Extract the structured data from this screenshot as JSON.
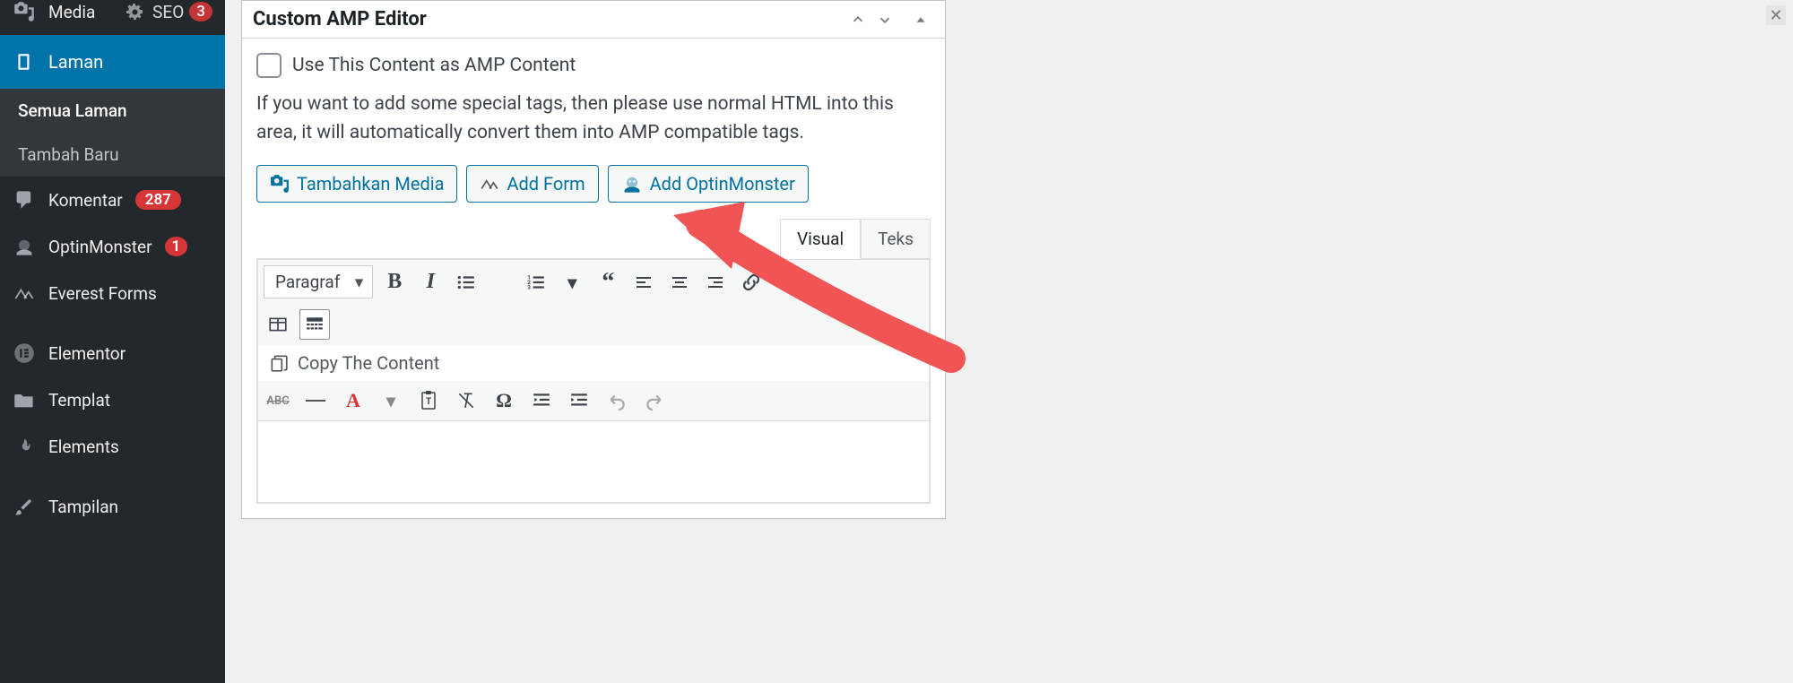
{
  "sidebar": {
    "media": "Media",
    "laman": "Laman",
    "semua_laman": "Semua Laman",
    "tambah_baru": "Tambah Baru",
    "komentar": "Komentar",
    "komentar_badge": "287",
    "optin": "OptinMonster",
    "optin_badge": "1",
    "everest": "Everest Forms",
    "elementor": "Elementor",
    "templat": "Templat",
    "elements": "Elements",
    "tampilan": "Tampilan",
    "seo": "SEO",
    "seo_badge": "3"
  },
  "panel": {
    "title": "Custom AMP Editor",
    "checkbox_label": "Use This Content as AMP Content",
    "description": "If you want to add some special tags, then please use normal HTML into this area, it will automatically convert them into AMP compatible tags.",
    "btn_media": "Tambahkan Media",
    "btn_form": "Add Form",
    "btn_optin": "Add OptinMonster",
    "tab_visual": "Visual",
    "tab_text": "Teks",
    "format": "Paragraf",
    "copy": "Copy The Content",
    "abc": "ABC"
  }
}
